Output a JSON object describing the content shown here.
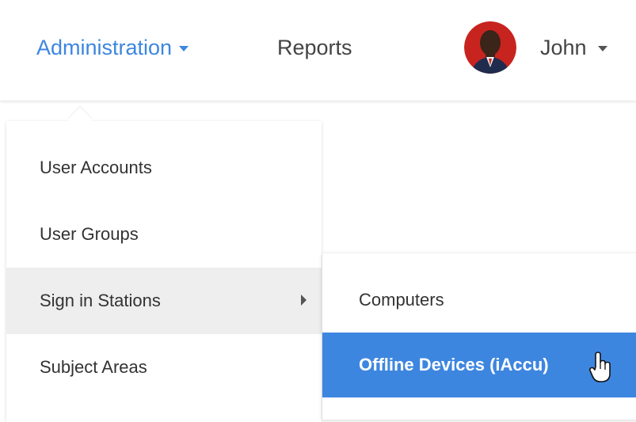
{
  "header": {
    "admin_label": "Administration",
    "reports_label": "Reports",
    "user_name": "John"
  },
  "menu": {
    "items": [
      {
        "label": "User Accounts"
      },
      {
        "label": "User Groups"
      },
      {
        "label": "Sign in Stations",
        "has_submenu": true,
        "active": true
      },
      {
        "label": "Subject Areas"
      }
    ]
  },
  "submenu": {
    "items": [
      {
        "label": "Computers"
      },
      {
        "label": "Offline Devices (iAccu)",
        "selected": true
      }
    ]
  },
  "colors": {
    "accent": "#3d86e0",
    "active_row": "#eeeeee",
    "text": "#333333"
  },
  "icons": {
    "admin_caret": "caret-down-icon",
    "user_caret": "caret-down-icon",
    "submenu_indicator": "caret-right-icon",
    "cursor": "hand-pointer-icon"
  }
}
